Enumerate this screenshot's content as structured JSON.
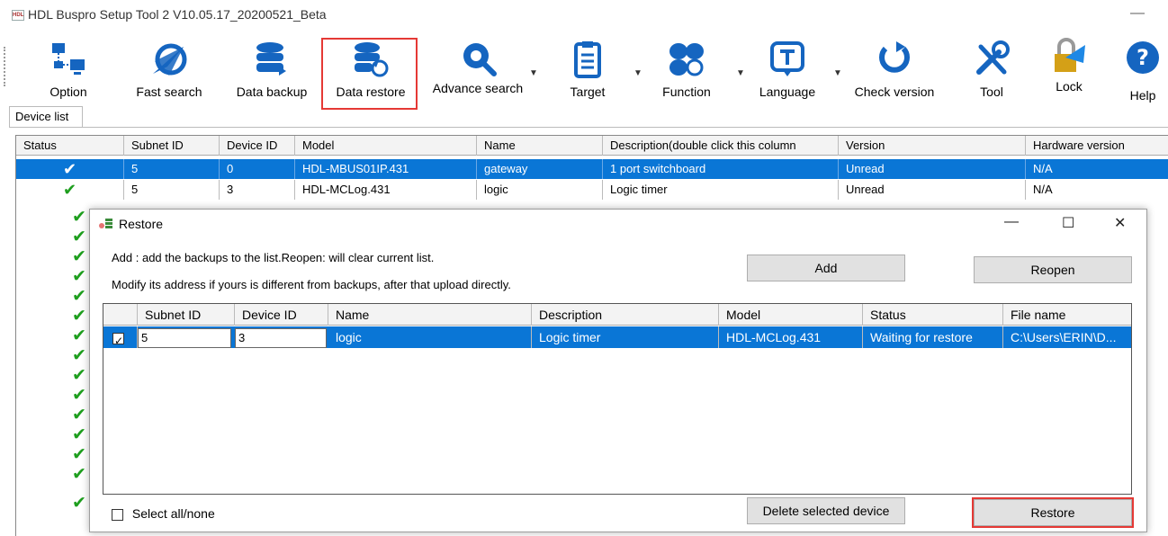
{
  "window": {
    "title": "HDL Buspro Setup Tool 2 V10.05.17_20200521_Beta",
    "app_icon": "HDL",
    "minimize_glyph": "—"
  },
  "toolbar": {
    "items": [
      {
        "label": "Option",
        "icon": "network-icon"
      },
      {
        "label": "Fast search",
        "icon": "paper-plane-icon"
      },
      {
        "label": "Data backup",
        "icon": "database-icon"
      },
      {
        "label": "Data restore",
        "icon": "database-restore-icon"
      },
      {
        "label": "Advance search",
        "icon": "gear-search-icon"
      },
      {
        "label": "Target",
        "icon": "clipboard-icon"
      },
      {
        "label": "Function",
        "icon": "cluster-icon"
      },
      {
        "label": "Language",
        "icon": "text-box-icon"
      },
      {
        "label": "Check version",
        "icon": "refresh-icon"
      },
      {
        "label": "Tool",
        "icon": "wrench-icon"
      },
      {
        "label": "Lock",
        "icon": "lock-icon"
      },
      {
        "label": "Help",
        "icon": "help-icon"
      }
    ],
    "dropdown_glyph": "▼",
    "accent": "#1565c0",
    "highlight_color": "#e53935"
  },
  "tabs": {
    "device_list": "Device list"
  },
  "device_grid": {
    "columns": [
      "Status",
      "Subnet ID",
      "Device ID",
      "Model",
      "Name",
      "Description(double click this column",
      "Version",
      "Hardware version"
    ],
    "rows": [
      {
        "status": "✔",
        "subnet": "5",
        "device": "0",
        "model": "HDL-MBUS01IP.431",
        "name": "gateway",
        "description": "1 port switchboard",
        "version": "Unread",
        "hardware": "N/A",
        "selected": true
      },
      {
        "status": "✔",
        "subnet": "5",
        "device": "3",
        "model": "HDL-MCLog.431",
        "name": "logic",
        "description": "Logic timer",
        "version": "Unread",
        "hardware": "N/A",
        "selected": false
      }
    ],
    "more_status_checks": [
      "✔",
      "✔",
      "✔",
      "✔",
      "✔",
      "✔",
      "✔",
      "✔",
      "✔",
      "✔",
      "✔",
      "✔",
      "✔",
      "✔",
      "✔"
    ],
    "selection_color": "#0a76d6",
    "check_color": "#1e9e1e"
  },
  "dialog": {
    "title": "Restore",
    "icon": "restore-small-icon",
    "controls": {
      "minimize": "—",
      "maximize": "☐",
      "close": "✕"
    },
    "instruction1": "Add : add the backups to the list.Reopen: will clear current list.",
    "instruction2": "Modify its address if yours is different from backups, after that upload directly.",
    "add_label": "Add",
    "reopen_label": "Reopen",
    "columns": [
      "",
      "Subnet ID",
      "Device ID",
      "Name",
      "Description",
      "Model",
      "Status",
      "File name"
    ],
    "rows": [
      {
        "checked": true,
        "subnet": "5",
        "device": "3",
        "name": "logic",
        "description": "Logic timer",
        "model": "HDL-MCLog.431",
        "status": "Waiting for restore",
        "file": "C:\\Users\\ERIN\\D..."
      }
    ],
    "select_all_label": "Select all/none",
    "delete_label": "Delete selected device",
    "restore_label": "Restore"
  }
}
